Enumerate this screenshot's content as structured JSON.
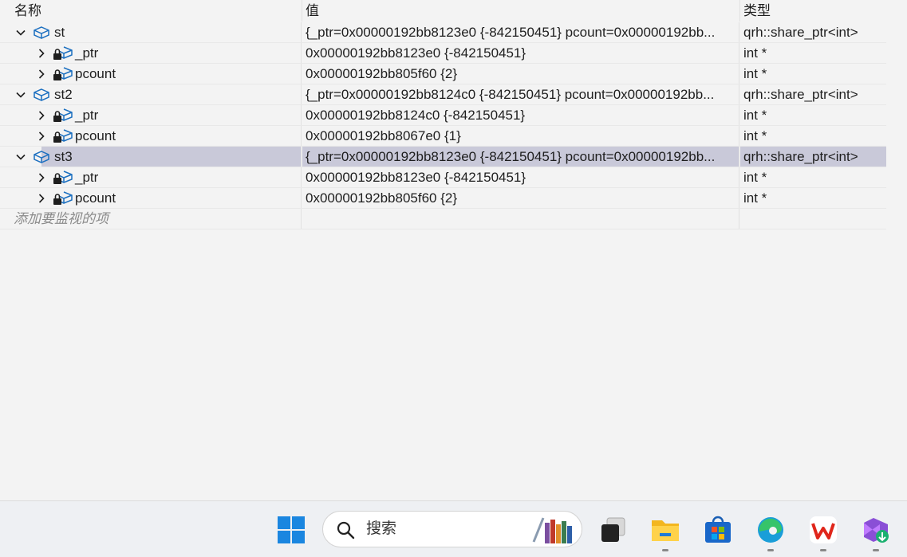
{
  "watch": {
    "headers": {
      "name": "名称",
      "value": "值",
      "type": "类型"
    },
    "rows": [
      {
        "level": 0,
        "expanded": true,
        "name": "st",
        "value": "{_ptr=0x00000192bb8123e0 {-842150451} pcount=0x00000192bb...",
        "type": "qrh::share_ptr<int>"
      },
      {
        "level": 1,
        "expanded": false,
        "name": "_ptr",
        "value": "0x00000192bb8123e0 {-842150451}",
        "type": "int *"
      },
      {
        "level": 1,
        "expanded": false,
        "name": "pcount",
        "value": "0x00000192bb805f60 {2}",
        "type": "int *"
      },
      {
        "level": 0,
        "expanded": true,
        "name": "st2",
        "value": "{_ptr=0x00000192bb8124c0 {-842150451} pcount=0x00000192bb...",
        "type": "qrh::share_ptr<int>"
      },
      {
        "level": 1,
        "expanded": false,
        "name": "_ptr",
        "value": "0x00000192bb8124c0 {-842150451}",
        "type": "int *"
      },
      {
        "level": 1,
        "expanded": false,
        "name": "pcount",
        "value": "0x00000192bb8067e0 {1}",
        "type": "int *"
      },
      {
        "level": 0,
        "expanded": true,
        "name": "st3",
        "value": "{_ptr=0x00000192bb8123e0 {-842150451} pcount=0x00000192bb...",
        "type": "qrh::share_ptr<int>",
        "selected": true
      },
      {
        "level": 1,
        "expanded": false,
        "name": "_ptr",
        "value": "0x00000192bb8123e0 {-842150451}",
        "type": "int *"
      },
      {
        "level": 1,
        "expanded": false,
        "name": "pcount",
        "value": "0x00000192bb805f60 {2}",
        "type": "int *"
      }
    ],
    "add_item_placeholder": "添加要监视的项"
  },
  "taskbar": {
    "search_placeholder": "搜索",
    "apps": [
      "windows-start-icon",
      "search-icon",
      "task-view-icon",
      "file-explorer-icon",
      "microsoft-store-icon",
      "edge-icon",
      "wps-office-icon",
      "visual-studio-icon"
    ]
  },
  "colors": {
    "selection": "#c9c9d9",
    "object_icon": "#1b6fc0",
    "background": "#f3f3f3"
  }
}
